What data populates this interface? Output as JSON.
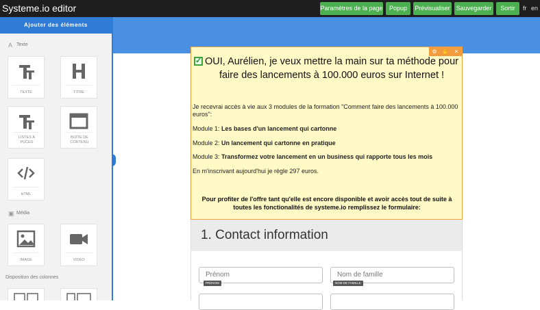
{
  "topbar": {
    "app_title": "Systeme.io editor",
    "buttons": [
      "Paramètres de la page",
      "Popup",
      "Prévisualiser",
      "Sauvegarder",
      "Sortir"
    ],
    "langs": [
      "fr",
      "en"
    ],
    "accent_color": "#4caf50"
  },
  "sidebar": {
    "header": "Ajouter des éléments",
    "sections": {
      "text": {
        "label": "Texte",
        "icon": "text-icon"
      },
      "media": {
        "label": "Média",
        "icon": "image-icon"
      },
      "columns": {
        "label": "Disposition des colonnes"
      }
    },
    "tiles": {
      "texte": "TEXTE",
      "titre": "TITRE",
      "listes": "LISTES À PUCES",
      "boite": "BOÎTE DE CONTENU",
      "html": "HTML",
      "image": "IMAGE",
      "video": "VIDÉO"
    },
    "accent_color": "#2f7bd5"
  },
  "optin": {
    "headline": "OUI, Aurélien, je veux mettre la main sur ta méthode pour faire des lancements à 100.000 euros sur Internet !",
    "intro": "Je recevrai accès à vie aux 3 modules de la formation \"Comment faire des lancements à 100.000 euros\":",
    "modules": [
      {
        "prefix": "Module 1:",
        "text": "Les bases d'un lancement qui cartonne"
      },
      {
        "prefix": "Module 2:",
        "text": "Un lancement qui cartonne en pratique"
      },
      {
        "prefix": "Module 3:",
        "text": "Transformez votre lancement en un business qui rapporte tous les mois"
      }
    ],
    "price_line": "En m'inscrivant aujourd'hui je règle 297 euros.",
    "cta_line": "Pour profiter de l'offre tant qu'elle est encore disponible et avoir accès tout de suite à toutes les fonctionalités de systeme.io remplissez le formulaire:",
    "background": "#fff9c6",
    "border_color": "#f0a040"
  },
  "form": {
    "section_title": "1.   Contact information",
    "fields": [
      {
        "placeholder": "Prénom",
        "tag": "PRÉNOM"
      },
      {
        "placeholder": "Nom de famille",
        "tag": "NOM DE FAMILLE"
      }
    ]
  }
}
